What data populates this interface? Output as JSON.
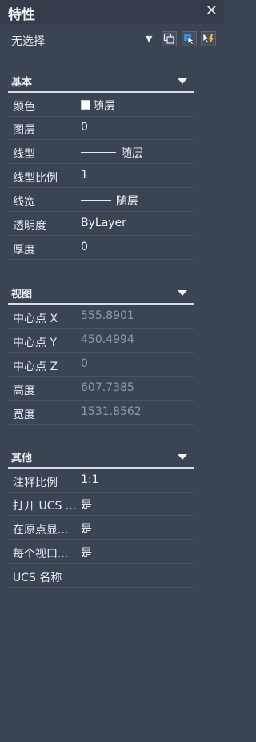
{
  "panel": {
    "title": "特性",
    "close_glyph": "✕"
  },
  "selection": {
    "value": "无选择"
  },
  "sections": {
    "basic": {
      "header": "基本",
      "rows": {
        "color": {
          "label": "颜色",
          "value": "随层"
        },
        "layer": {
          "label": "图层",
          "value": "0"
        },
        "linetype": {
          "label": "线型",
          "value": "随层"
        },
        "ltscale": {
          "label": "线型比例",
          "value": "1"
        },
        "lineweight": {
          "label": "线宽",
          "value": "随层"
        },
        "transparency": {
          "label": "透明度",
          "value": "ByLayer"
        },
        "thickness": {
          "label": "厚度",
          "value": "0"
        }
      }
    },
    "view": {
      "header": "视图",
      "rows": {
        "cx": {
          "label": "中心点 X",
          "value": "555.8901"
        },
        "cy": {
          "label": "中心点 Y",
          "value": "450.4994"
        },
        "cz": {
          "label": "中心点 Z",
          "value": "0"
        },
        "height": {
          "label": "高度",
          "value": "607.7385"
        },
        "width": {
          "label": "宽度",
          "value": "1531.8562"
        }
      }
    },
    "misc": {
      "header": "其他",
      "rows": {
        "annoscale": {
          "label": "注释比例",
          "value": "1:1"
        },
        "ucs_on": {
          "label": "打开 UCS ...",
          "value": "是"
        },
        "at_origin": {
          "label": "在原点显...",
          "value": "是"
        },
        "per_vp": {
          "label": "每个视口...",
          "value": "是"
        },
        "ucs_name": {
          "label": "UCS 名称",
          "value": ""
        }
      }
    }
  },
  "colors": {
    "panel_bg": "#3b4453",
    "title_bg": "#343c4a",
    "accent": "#2f8ee6",
    "bolt": "#f2c230"
  }
}
